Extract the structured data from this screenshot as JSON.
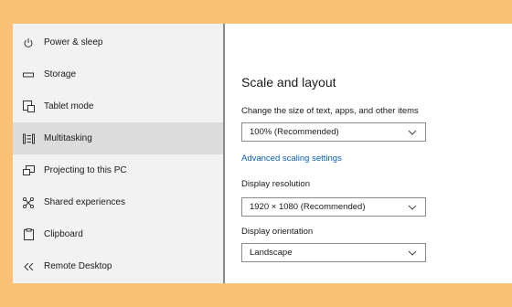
{
  "sidebar": {
    "items": [
      {
        "label": "Power & sleep",
        "icon": "power-icon"
      },
      {
        "label": "Storage",
        "icon": "storage-icon"
      },
      {
        "label": "Tablet mode",
        "icon": "tablet-mode-icon"
      },
      {
        "label": "Multitasking",
        "icon": "multitasking-icon",
        "selected": true
      },
      {
        "label": "Projecting to this PC",
        "icon": "projecting-icon"
      },
      {
        "label": "Shared experiences",
        "icon": "shared-experiences-icon"
      },
      {
        "label": "Clipboard",
        "icon": "clipboard-icon"
      },
      {
        "label": "Remote Desktop",
        "icon": "remote-desktop-icon"
      }
    ]
  },
  "main": {
    "heading": "Scale and layout",
    "scale_label": "Change the size of text, apps, and other items",
    "scale_value": "100% (Recommended)",
    "advanced_link": "Advanced scaling settings",
    "resolution_label": "Display resolution",
    "resolution_value": "1920 × 1080 (Recommended)",
    "orientation_label": "Display orientation",
    "orientation_value": "Landscape"
  },
  "colors": {
    "background": "#f9c277",
    "sidebar": "#f2f2f2",
    "selected": "#dcdcdc",
    "link": "#0a5fb4"
  }
}
